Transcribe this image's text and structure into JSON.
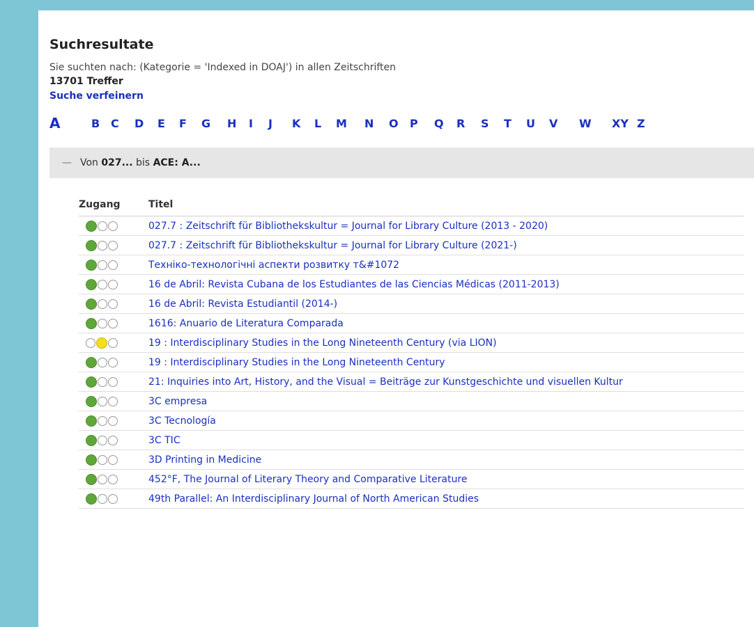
{
  "header": {
    "title": "Suchresultate",
    "search_desc": "Sie suchten nach: (Kategorie = 'Indexed in DOAJ') in allen Zeitschriften",
    "hits": "13701 Treffer",
    "refine": "Suche verfeinern"
  },
  "alphabet": {
    "active": "A",
    "letters": [
      "B",
      "C",
      "D",
      "E",
      "F",
      "G",
      "H",
      "I",
      "J",
      "K",
      "L",
      "M",
      "N",
      "O",
      "P",
      "Q",
      "R",
      "S",
      "T",
      "U",
      "V",
      "W",
      "XY",
      "Z"
    ]
  },
  "section": {
    "collapse_icon": "minus-icon",
    "prefix": "Von",
    "from": "027...",
    "middle": "bis",
    "to": "ACE: A..."
  },
  "table": {
    "col_access": "Zugang",
    "col_title": "Titel",
    "rows": [
      {
        "access": "green",
        "title": "027.7 : Zeitschrift für Bibliothekskultur = Journal for Library Culture (2013 - 2020)"
      },
      {
        "access": "green",
        "title": "027.7 : Zeitschrift für Bibliothekskultur = Journal for Library Culture (2021-)"
      },
      {
        "access": "green",
        "title": "Техніко-технологічні аспекти розвитку т&#1072"
      },
      {
        "access": "green",
        "title": "16 de Abril: Revista Cubana de los Estudiantes de las Ciencias Médicas (2011-2013)"
      },
      {
        "access": "green",
        "title": "16 de Abril: Revista Estudiantil (2014-)"
      },
      {
        "access": "green",
        "title": "1616: Anuario de Literatura Comparada"
      },
      {
        "access": "yellow",
        "title": "19 : Interdisciplinary Studies in the Long Nineteenth Century (via LION)"
      },
      {
        "access": "green",
        "title": "19 : Interdisciplinary Studies in the Long Nineteenth Century"
      },
      {
        "access": "green",
        "title": "21: Inquiries into Art, History, and the Visual = Beiträge zur Kunstgeschichte und visuellen Kultur"
      },
      {
        "access": "green",
        "title": "3C empresa"
      },
      {
        "access": "green",
        "title": "3C Tecnología"
      },
      {
        "access": "green",
        "title": "3C TIC"
      },
      {
        "access": "green",
        "title": "3D Printing in Medicine"
      },
      {
        "access": "green",
        "title": "452°F, The Journal of Literary Theory and Comparative Literature"
      },
      {
        "access": "green",
        "title": "49th Parallel: An Interdisciplinary Journal of North American Studies"
      }
    ]
  },
  "colors": {
    "background": "#7ec5d6",
    "link": "#1a2fc0",
    "green_light": "#5fa73a",
    "yellow_light": "#f2e01c"
  }
}
